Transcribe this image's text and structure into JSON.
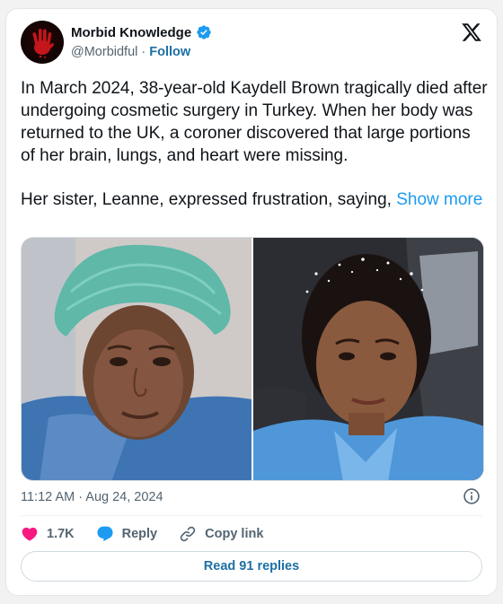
{
  "author": {
    "display_name": "Morbid Knowledge",
    "handle": "@Morbidful",
    "separator": "·",
    "follow_label": "Follow",
    "verified": true
  },
  "tweet": {
    "paragraph_1": "In March 2024, 38-year-old Kaydell Brown tragically died after undergoing cosmetic surgery in Turkey. When her body was returned to the UK, a coroner discovered that large portions of her brain, lungs, and heart were missing.",
    "paragraph_2": "Her sister, Leanne, expressed frustration, saying,",
    "show_more_label": "Show more"
  },
  "media": {
    "photos": [
      "left",
      "right"
    ]
  },
  "meta": {
    "timestamp": "11:12 AM · Aug 24, 2024"
  },
  "actions": {
    "likes": "1.7K",
    "reply_label": "Reply",
    "copy_link_label": "Copy link"
  },
  "replies_button": "Read 91 replies",
  "colors": {
    "link": "#1d9bf0",
    "follow": "#1d6fa5",
    "heart": "#f91880",
    "verified": "#1d9bf0",
    "muted": "#536471"
  },
  "icons": [
    "x-logo-icon",
    "verified-badge-icon",
    "heart-icon",
    "reply-bubble-icon",
    "link-icon",
    "info-icon"
  ]
}
